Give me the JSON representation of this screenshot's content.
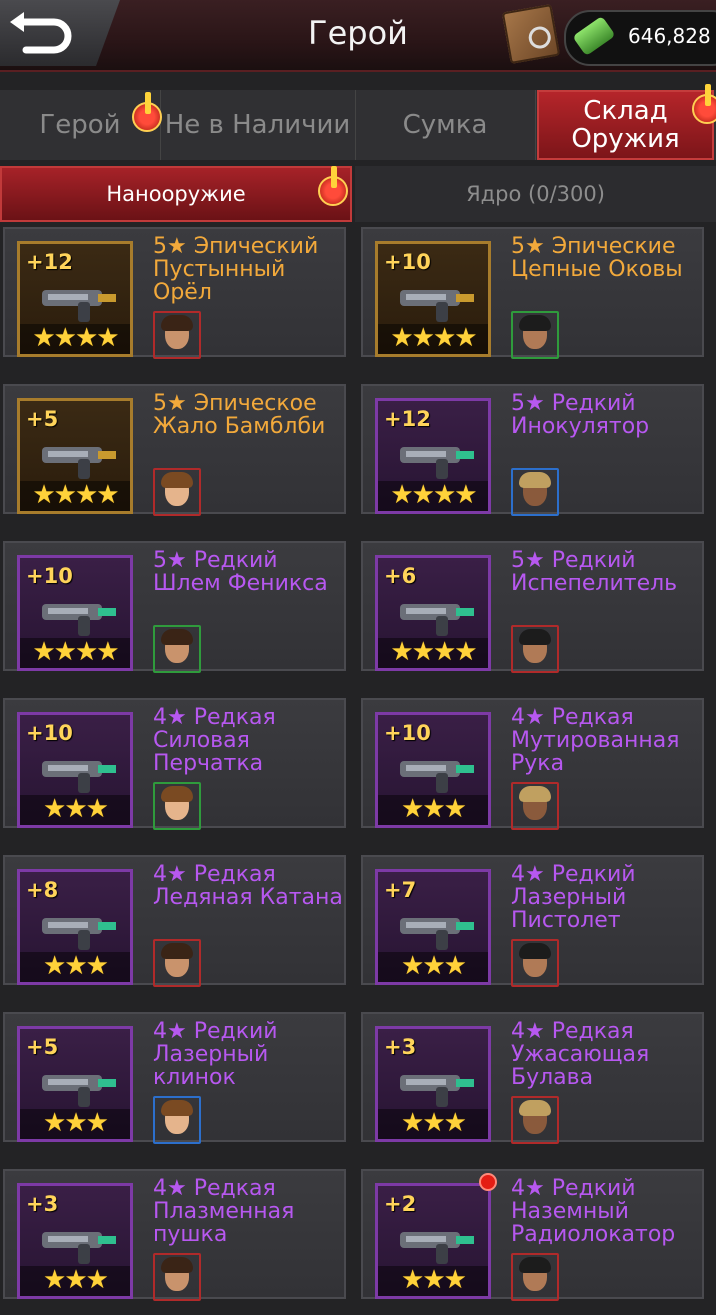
{
  "header": {
    "title": "Герой",
    "currency_value": "646,828"
  },
  "tabs": [
    {
      "label": "Герой",
      "alert": true
    },
    {
      "label": "Не в Наличии",
      "alert": false
    },
    {
      "label": "Сумка",
      "alert": false
    },
    {
      "label": "Склад Оружия",
      "alert": true,
      "active": true
    }
  ],
  "subtabs": [
    {
      "label": "Нанооружие",
      "active": true,
      "alert": true
    },
    {
      "label": "Ядро (0/300)",
      "active": false
    }
  ],
  "items": [
    {
      "level": "+12",
      "stars": 4,
      "name": "5★ Эпический Пустынный Орёл",
      "rarity": "gold",
      "weapon_icon": "pistol-icon",
      "hero_border": "red"
    },
    {
      "level": "+10",
      "stars": 4,
      "name": "5★ Эпические Цепные Оковы",
      "rarity": "gold",
      "weapon_icon": "chain-shackles-icon",
      "hero_border": "green"
    },
    {
      "level": "+5",
      "stars": 4,
      "name": "5★ Эпическое Жало Бамблби",
      "rarity": "gold",
      "weapon_icon": "stinger-icon",
      "hero_border": "red"
    },
    {
      "level": "+12",
      "stars": 4,
      "name": "5★ Редкий Инокулятор",
      "rarity": "purple",
      "weapon_icon": "rifle-icon",
      "hero_border": "blue"
    },
    {
      "level": "+10",
      "stars": 4,
      "name": "5★ Редкий Шлем Феникса",
      "rarity": "purple",
      "weapon_icon": "helmet-icon",
      "hero_border": "green"
    },
    {
      "level": "+6",
      "stars": 4,
      "name": "5★ Редкий Испепелитель",
      "rarity": "purple",
      "weapon_icon": "flamethrower-icon",
      "hero_border": "red"
    },
    {
      "level": "+10",
      "stars": 3,
      "name": "4★ Редкая Силовая Перчатка",
      "rarity": "purple",
      "weapon_icon": "power-glove-icon",
      "hero_border": "green"
    },
    {
      "level": "+10",
      "stars": 3,
      "name": "4★ Редкая Мутированная Рука",
      "rarity": "purple",
      "weapon_icon": "mutant-arm-icon",
      "hero_border": "red"
    },
    {
      "level": "+8",
      "stars": 3,
      "name": "4★ Редкая Ледяная Катана",
      "rarity": "purple",
      "weapon_icon": "katana-icon",
      "hero_border": "red"
    },
    {
      "level": "+7",
      "stars": 3,
      "name": "4★ Редкий Лазерный Пистолет",
      "rarity": "purple",
      "weapon_icon": "laser-pistol-icon",
      "hero_border": "red"
    },
    {
      "level": "+5",
      "stars": 3,
      "name": "4★ Редкий Лазерный клинок",
      "rarity": "purple",
      "weapon_icon": "laser-blade-icon",
      "hero_border": "blue"
    },
    {
      "level": "+3",
      "stars": 3,
      "name": "4★ Редкая Ужасающая Булава",
      "rarity": "purple",
      "weapon_icon": "mace-icon",
      "hero_border": "red"
    },
    {
      "level": "+3",
      "stars": 3,
      "name": "4★ Редкая Плазменная пушка",
      "rarity": "purple",
      "weapon_icon": "plasma-cannon-icon",
      "hero_border": "red"
    },
    {
      "level": "+2",
      "stars": 3,
      "name": "4★ Редкий Наземный Радиолокатор",
      "rarity": "purple",
      "weapon_icon": "radar-icon",
      "hero_border": "red",
      "new_dot": true
    }
  ]
}
